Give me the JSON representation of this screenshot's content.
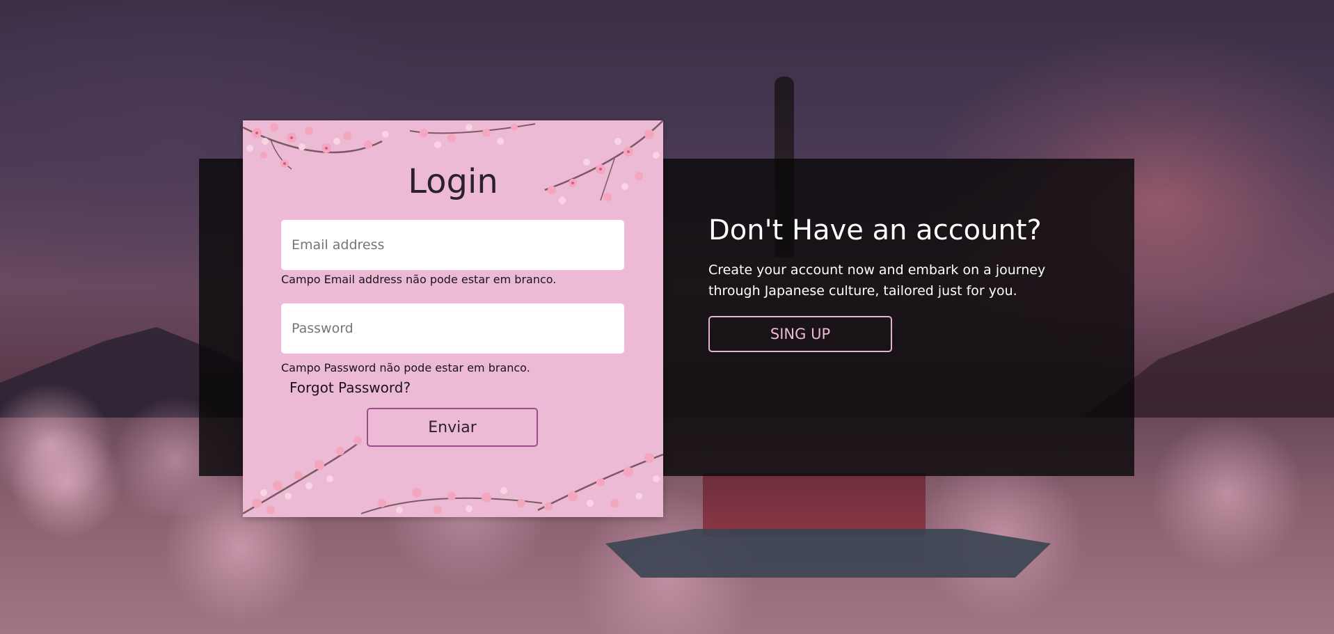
{
  "login": {
    "title": "Login",
    "email": {
      "placeholder": "Email address",
      "error": "Campo Email address não pode estar em branco."
    },
    "password": {
      "placeholder": "Password",
      "error": "Campo Password não pode estar em branco."
    },
    "forgot_label": "Forgot Password?",
    "submit_label": "Enviar"
  },
  "signup": {
    "title": "Don't Have an account?",
    "text": "Create your account now and embark on a journey through Japanese culture, tailored just for you.",
    "button_label": "SING UP"
  },
  "colors": {
    "card_background": "#ecbad5",
    "submit_border": "#9a4e8a",
    "signup_accent": "#ecbad5",
    "panel_background": "#0a080a"
  }
}
